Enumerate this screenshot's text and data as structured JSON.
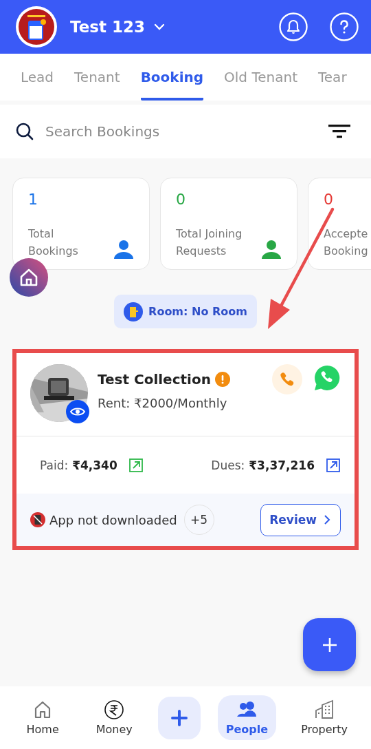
{
  "header": {
    "title": "Test 123"
  },
  "tabs": [
    {
      "label": "Lead",
      "selected": false
    },
    {
      "label": "Tenant",
      "selected": false
    },
    {
      "label": "Booking",
      "selected": true
    },
    {
      "label": "Old Tenant",
      "selected": false
    },
    {
      "label": "Tear",
      "selected": false
    }
  ],
  "search": {
    "placeholder": "Search Bookings"
  },
  "stats": [
    {
      "value": "1",
      "label": [
        "Total",
        "Bookings"
      ],
      "color": "#1a73e8"
    },
    {
      "value": "0",
      "label": [
        "Total Joining",
        "Requests"
      ],
      "color": "#28a745"
    },
    {
      "value": "0",
      "label": [
        "Accepte",
        "Booking"
      ],
      "color": "#e53935"
    }
  ],
  "room_chip": {
    "label": "Room: No Room"
  },
  "booking": {
    "name": "Test Collection",
    "rent": "Rent: ₹2000/Monthly",
    "paid_label": "Paid:",
    "paid": "₹4,340",
    "dues_label": "Dues:",
    "dues": "₹3,37,216",
    "app_status": "App not downloaded",
    "extra_count": "+5",
    "review": "Review"
  },
  "nav": [
    {
      "label": "Home",
      "kind": "home",
      "selected": false
    },
    {
      "label": "Money",
      "kind": "money",
      "selected": false
    },
    {
      "kind": "add",
      "selected": false
    },
    {
      "label": "People",
      "kind": "people",
      "selected": true
    },
    {
      "label": "Property",
      "kind": "property",
      "selected": false
    }
  ]
}
